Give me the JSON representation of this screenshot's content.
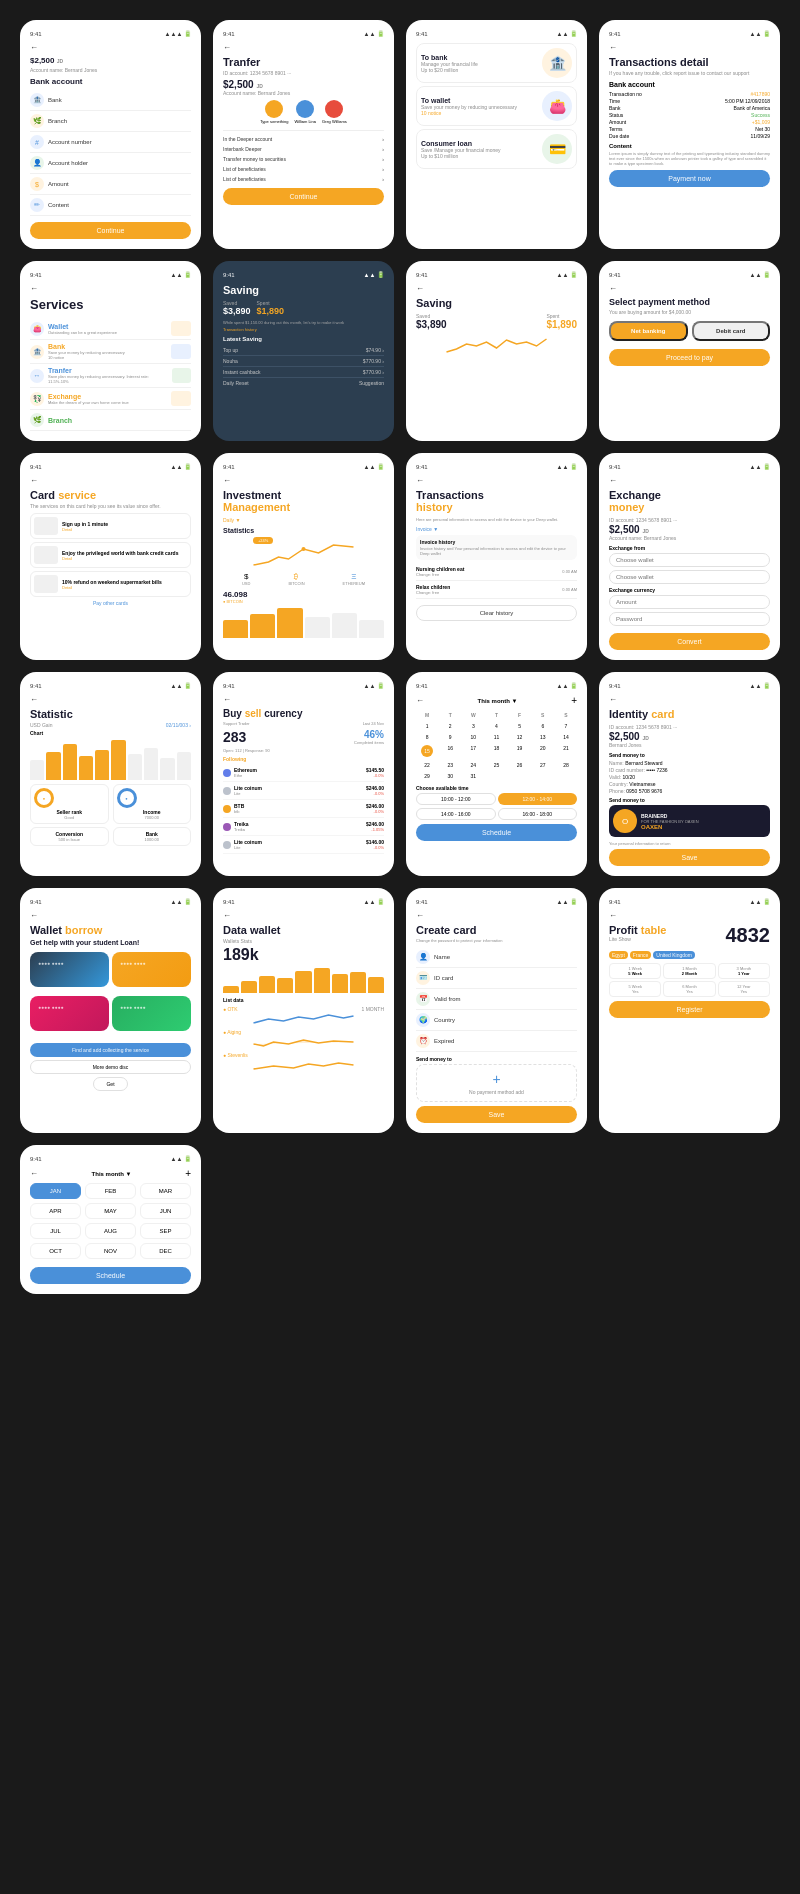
{
  "cards": [
    {
      "id": "bank-account",
      "status_time": "9:41",
      "title": "Bank account",
      "amount": "$2,500",
      "account_label": "Account name",
      "account_name": "Bernard Jones",
      "fields": [
        "Bank",
        "Branch",
        "Account number",
        "Account holder",
        "Amount",
        "Content"
      ],
      "btn": "Continue"
    },
    {
      "id": "transfer",
      "status_time": "9:41",
      "title": "Tranfer",
      "account_id": "1234 5678 8901",
      "amount": "$2,500",
      "account_label": "Account name: Bernard Jones",
      "btn": "Continue",
      "menu_items": [
        "In the Deeper account",
        "Interbank Deeper",
        "Transfer money to securities",
        "List of beneficiaries",
        "List of beneficiaries"
      ]
    },
    {
      "id": "to-bank",
      "status_time": "9:41",
      "options": [
        "To bank",
        "To wallet",
        "Consumer loan"
      ],
      "to_bank_desc": "Manage your financial life",
      "to_bank_amount": "Up to $20 million",
      "to_wallet_desc": "Save your money by reducing unnecessary",
      "to_wallet_notice": "10 notice",
      "consumer_desc": "Save /Manage your financial money",
      "consumer_amount": "Up to $10 million"
    },
    {
      "id": "transactions-detail",
      "status_time": "9:41",
      "title": "Transactions detail",
      "subtitle": "If you have any trouble, click report issue to contact our support",
      "bank_account": "Bank account",
      "transaction_no": "#417890",
      "transaction_time": "5:00 PM 12/09/2018",
      "bank_name": "Bank of America",
      "status": "Success",
      "amount": "+$1,009",
      "terms": "Net 30",
      "due_date": "11/09/29",
      "btn": "Payment now"
    },
    {
      "id": "services",
      "status_time": "9:41",
      "title": "Services",
      "items": [
        {
          "name": "Wallet",
          "desc": "Outstanding can be a great experience"
        },
        {
          "name": "Bank",
          "desc": "Save your money by reducing unnecessary"
        },
        {
          "name": "Tranfer",
          "desc": "Save plan money by reducing unnecessary, Interest rate: 11.5%-10%"
        },
        {
          "name": "Exchange",
          "desc": "Make the dream of your own home come true"
        },
        {
          "name": "Branch",
          "desc": ""
        }
      ]
    },
    {
      "id": "saving-dark",
      "status_time": "9:41",
      "title": "Saving",
      "saved": "$3,890",
      "spent": "$1,890",
      "desc": "While spent $1,150.00 during out this month, let's try to make it work",
      "link": "Transaction history",
      "latest_saving_title": "Latest Saving",
      "items": [
        {
          "name": "Top up",
          "amount": "$74.90"
        },
        {
          "name": "Nouha",
          "amount": "$770.90"
        },
        {
          "name": "Instant cashback",
          "amount": "$770.90"
        },
        {
          "name": "Daily Reset",
          "desc": "Suggestion"
        }
      ]
    },
    {
      "id": "saving-light",
      "status_time": "9:41",
      "title": "Saving",
      "saved_label": "Saved",
      "spent_label": "Spent",
      "saved": "$3,890",
      "spent": "$1,890"
    },
    {
      "id": "select-payment",
      "status_time": "9:41",
      "title": "Select payment method",
      "desc": "You are buying amount for $4,000.00",
      "methods": [
        "Net banking",
        "Debit card"
      ],
      "btn": "Proceed to pay"
    },
    {
      "id": "card-service",
      "status_time": "9:41",
      "title": "Card service",
      "desc": "The services on this card help you see its value since offer.",
      "items": [
        {
          "text": "Sign up in 1 minute",
          "detail": "Detail"
        },
        {
          "text": "Enjoy the privileged world with bank credit cards",
          "detail": "Detail"
        },
        {
          "text": "10% refund on weekend supermarket bills",
          "detail": "Detail"
        }
      ],
      "link": "Pay other cards"
    },
    {
      "id": "investment-management",
      "status_time": "9:41",
      "title1": "Investment",
      "title2": "Management",
      "filter": "Daily",
      "section": "Statistics",
      "cryptos": [
        "USD",
        "BITCOIN",
        "ETHEREUM"
      ],
      "btc_value": "46.098",
      "btc_label": "BITCOIN"
    },
    {
      "id": "transactions-history",
      "status_time": "9:41",
      "title1": "Transactions",
      "title2": "history",
      "subtitle": "Here are personal information to access and edit the device to your Deep wallet.",
      "filter": "Invoice",
      "sub_filter": "Invoice history",
      "sub_desc": "Invoice history and Your personal information to access and edit the device to your Deep wallet",
      "items": [
        {
          "name": "Nursing children eat",
          "type": "Change: free",
          "amount": "0.00 AM"
        },
        {
          "name": "Relax children",
          "type": "Change: free",
          "amount": "0.00 AM"
        }
      ],
      "btn": "Clear history"
    },
    {
      "id": "exchange-money",
      "status_time": "9:41",
      "title1": "Exchange",
      "title2": "money",
      "account_id": "1234 5678 8901",
      "amount": "$2,500",
      "account_name": "Bernard Jones",
      "exchange_from_label": "Exchange from",
      "wallet_placeholder": "Choose wallet",
      "currency_label": "Exchange currency",
      "amount_label": "Amount",
      "password_label": "Password",
      "btn": "Convert"
    },
    {
      "id": "statistic",
      "status_time": "9:41",
      "title": "Statistic",
      "usd_gain_label": "USD Gain",
      "date": "02/11/003",
      "chart_label": "Chart",
      "bars": [
        40,
        60,
        80,
        55,
        70,
        90,
        65,
        75,
        85,
        50
      ],
      "seller_rank_label": "Seller rank",
      "seller_rank": "Good",
      "income_label": "Income",
      "income": "7000.00",
      "conversion_label": "Conversion",
      "conversion": "500 in Issue",
      "bank_label": "Bank",
      "bank": "1000.00"
    },
    {
      "id": "buy-sell",
      "status_time": "9:41",
      "title1": "Buy",
      "title2": "sell",
      "title3": "curency",
      "support_trader": "Support Trader",
      "last24": "Last 24 Nov",
      "value": "283",
      "open": "Open: 112",
      "response": "Response: 90",
      "percent": "46%",
      "percent_label": "Completed items",
      "following": "Following",
      "cryptos": [
        {
          "name": "Ethereum",
          "sub": "Ethe",
          "val": "$145.50",
          "change": "-0.0%"
        },
        {
          "name": "Lite coinum",
          "sub": "Lite",
          "val": "$246.00",
          "change": "-0.0%"
        },
        {
          "name": "BTB",
          "sub": "btb",
          "val": "$246.00",
          "change": "-0.0%"
        },
        {
          "name": "Treika",
          "sub": "Treika",
          "val": "$246.00",
          "change": "-1.05%"
        },
        {
          "name": "Lite coinum",
          "sub": "Lite",
          "val": "$146.00",
          "change": "-0.0%"
        }
      ]
    },
    {
      "id": "schedule",
      "status_time": "9:41",
      "this_month": "This month",
      "days_header": [
        "M",
        "T",
        "W",
        "T",
        "F",
        "S",
        "S"
      ],
      "rows": [
        [
          1,
          2,
          3,
          4,
          5,
          6,
          7
        ],
        [
          8,
          9,
          10,
          11,
          12,
          13,
          14
        ],
        [
          15,
          16,
          17,
          18,
          19,
          20,
          21
        ],
        [
          22,
          23,
          24,
          25,
          26,
          27,
          28
        ],
        [
          29,
          30,
          31,
          "",
          "",
          "",
          ""
        ]
      ],
      "today": 15,
      "time_slots_label": "Choose available time",
      "morning_slots": [
        "10:00 - 12:00",
        "12:00 - 14:00"
      ],
      "afternoon_slots": [
        "14:00 - 16:00",
        "16:00 - 18:00"
      ],
      "btn": "Schedule"
    },
    {
      "id": "identity-card",
      "status_time": "9:41",
      "title1": "Identity",
      "title2": "card",
      "account_id": "1234 5678 8901",
      "amount": "$2,500",
      "amount_label": "JD",
      "account_name": "Bernard Jones",
      "send_money_label": "Send money to",
      "name": "Bernard Steward",
      "id_card": "••••• 7236",
      "valid": "10/20",
      "country": "Vietnamese",
      "phone": "0950 5708 9676",
      "send_money_label2": "Send money to",
      "brand": "OAXEN",
      "brand_desc": "BRAINERD - FOR THE FASHION BY OAXEN",
      "save_btn": "Save"
    },
    {
      "id": "wallet-borrow",
      "status_time": "9:41",
      "title1": "Wallet",
      "title2": "borrow",
      "subtitle": "Get help with your student Loan!",
      "cards": [
        "card1",
        "card2",
        "card3",
        "card4"
      ],
      "loan_btn": "Find and add collecting the service",
      "demo_btn": "More demo disc",
      "get_btn": "Get"
    },
    {
      "id": "data-wallet",
      "status_time": "9:41",
      "title": "Data wallet",
      "wallet_status": "Wallets Stats",
      "value": "189k",
      "list_data_label": "List data",
      "items": [
        {
          "name": "OTK",
          "period": "1 MONTH"
        },
        {
          "name": "Aiging",
          "period": ""
        },
        {
          "name": "Stevenlis",
          "period": ""
        }
      ]
    },
    {
      "id": "create-card",
      "status_time": "9:41",
      "title": "Create card",
      "subtitle": "Change the password to protect your information",
      "fields": [
        "Name",
        "ID card",
        "Valid from",
        "Country",
        "Expired"
      ],
      "send_money_label": "Send money to",
      "no_payment_msg": "No payment method add",
      "btn": "Save"
    },
    {
      "id": "profit-table",
      "status_time": "9:41",
      "title1": "Profit",
      "title2": "table",
      "number": "4832",
      "lite_show": "Lite Show",
      "countries": [
        "Egypt",
        "France",
        "United Kingdom"
      ],
      "periods": [
        {
          "label": "1 Week",
          "val": "5 Week"
        },
        {
          "label": "1 Month",
          "val": "2 Month"
        },
        {
          "label": "3 Month",
          "val": "1 Year"
        },
        {
          "label": "5 Week",
          "val": ""
        },
        {
          "label": "6 Month",
          "val": "12 Year"
        }
      ],
      "btn": "Register"
    },
    {
      "id": "month-schedule",
      "status_time": "9:41",
      "this_month": "This month",
      "months": [
        "JAN",
        "FEB",
        "MAR",
        "APR",
        "MAY",
        "JUN",
        "JUL",
        "AUG",
        "SEP",
        "OCT",
        "NOV",
        "DEC"
      ],
      "active_month": "JAN",
      "btn": "Schedule"
    }
  ],
  "colors": {
    "yellow": "#F5A623",
    "blue": "#4A90D9",
    "dark": "#1a1a2e",
    "white": "#ffffff",
    "light_gray": "#f5f5f5",
    "text_gray": "#888888",
    "green": "#4CAF50",
    "red": "#e74c3c"
  }
}
